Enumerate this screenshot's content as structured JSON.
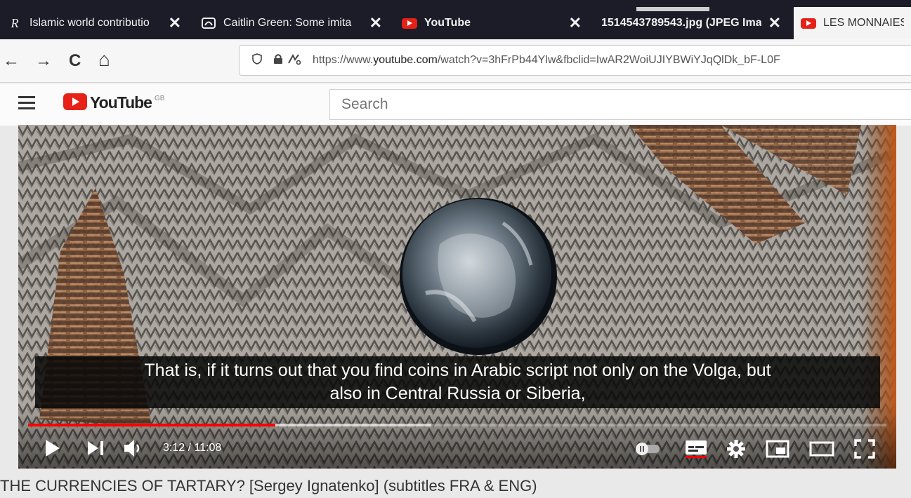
{
  "tabs": [
    {
      "title": "Islamic world contributio",
      "icon": "r-icon",
      "close": "✕"
    },
    {
      "title": "Caitlin Green: Some imita",
      "icon": "page-icon",
      "close": "✕"
    },
    {
      "title": "YouTube",
      "icon": "youtube-icon",
      "close": "✕"
    },
    {
      "title": "1514543789543.jpg (JPEG Ima",
      "icon": "none",
      "close": "✕"
    },
    {
      "title": "LES MONNAIES",
      "icon": "youtube-icon",
      "active": true
    }
  ],
  "nav": {
    "back": "←",
    "forward": "→",
    "reload": "C",
    "home": "⌂",
    "url_prefix": "https://www.",
    "url_domain": "youtube.com",
    "url_rest": "/watch?v=3hFrPb44Ylw&fbclid=IwAR2WoiUJIYBWiYJqQlDk_bF-L0F"
  },
  "youtube": {
    "logo_text": "YouTube",
    "region": "GB",
    "search_placeholder": "Search"
  },
  "player": {
    "caption_line1": "That is, if it turns out that you find coins in Arabic script not only on the Volga, but",
    "caption_line2": "also in Central Russia or Siberia,",
    "time": "3:12 / 11:08",
    "progress_played": 0.288,
    "progress_loaded": 0.47
  },
  "video_title": "THE CURRENCIES OF TARTARY? [Sergey Ignatenko] (subtitles FRA & ENG)",
  "colors": {
    "youtube_red": "#e62117",
    "progress_red": "#ff0000",
    "tabstrip": "#1c1c28"
  }
}
